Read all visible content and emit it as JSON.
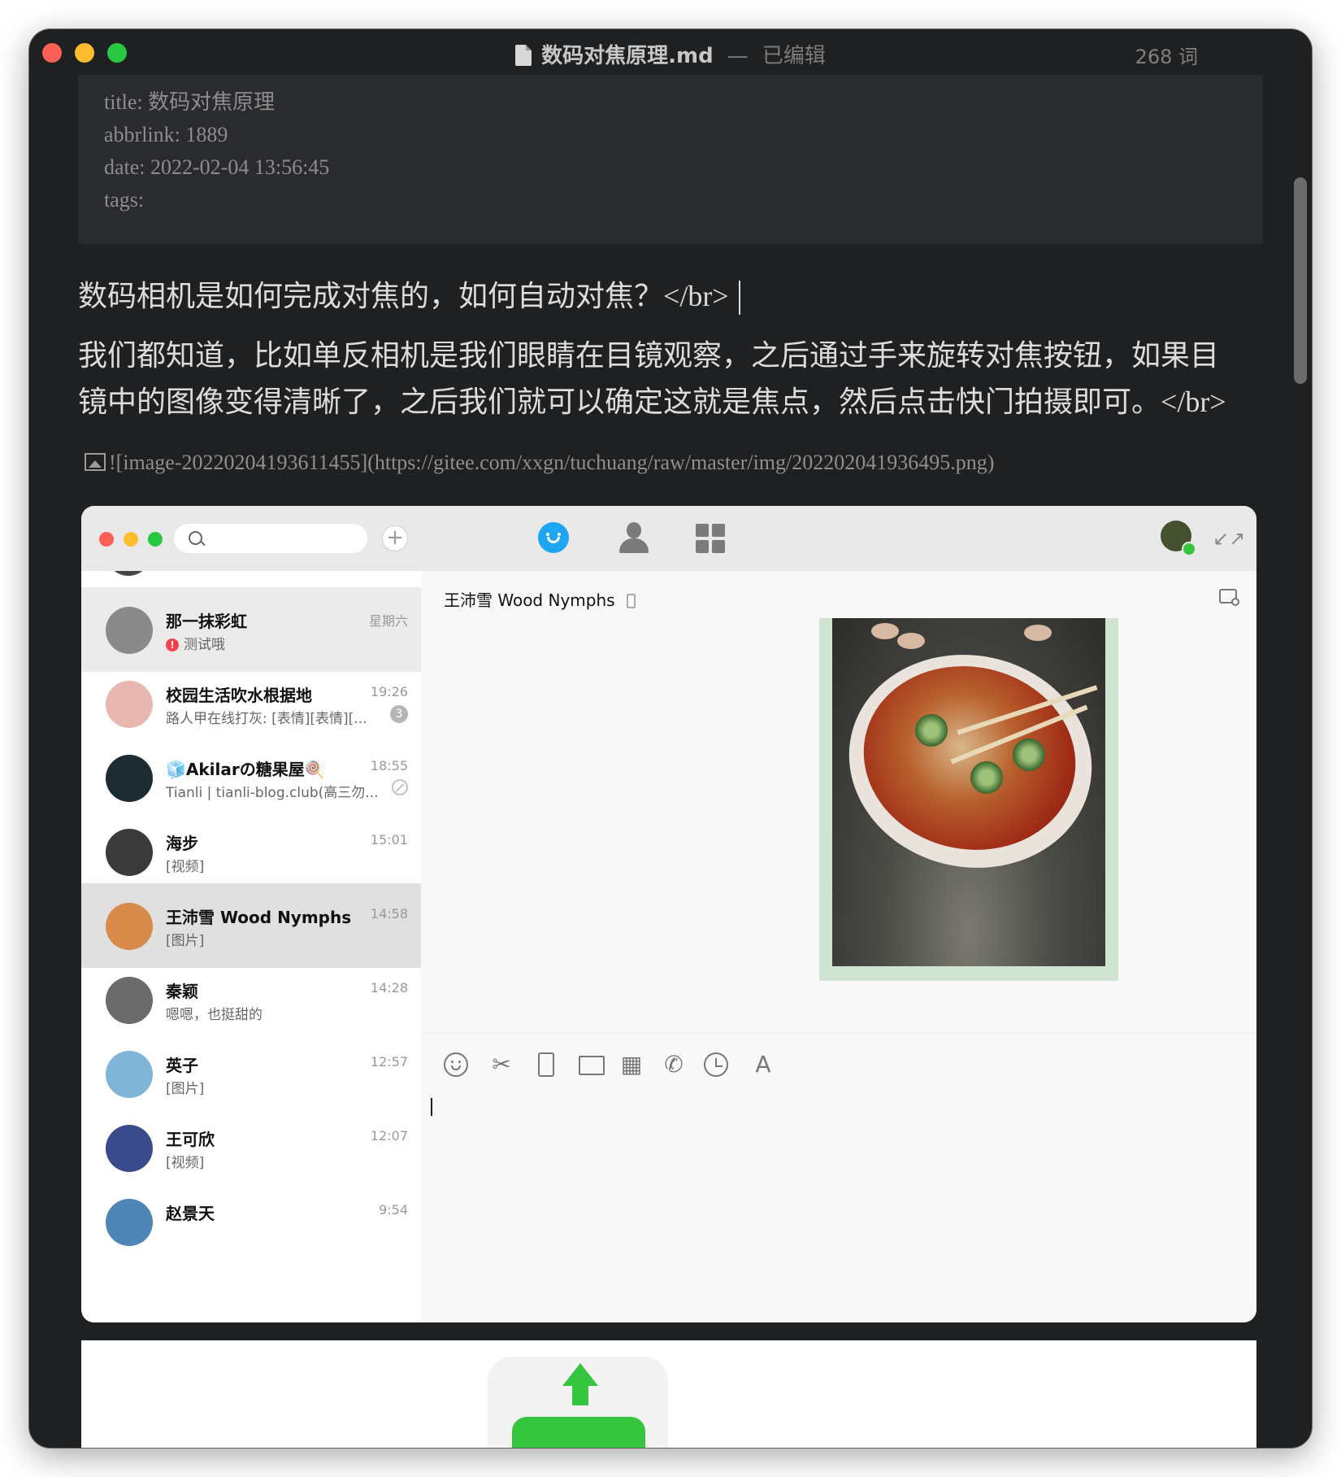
{
  "window": {
    "title": "数码对焦原理.md",
    "separator": "—",
    "edited": "已编辑",
    "word_count": "268 词"
  },
  "frontmatter": {
    "lines": [
      "title: 数码对焦原理",
      "abbrlink: 1889",
      "date: 2022-02-04 13:56:45",
      "tags:"
    ]
  },
  "body": {
    "p1_text": "数码相机是如何完成对焦的，如何自动对焦？",
    "p1_tag": "</br>",
    "p2_line1": "我们都知道，比如单反相机是我们眼睛在目镜观察，之后通过手来旋转对焦按钮，如果目",
    "p2_line2": "镜中的图像变得清晰了，之后我们就可以确定这就是焦点，然后点击快门拍摄即可。",
    "p2_tag": "</br>",
    "image_markdown": "![image-20220204193611455](https://gitee.com/xxgn/tuchuang/raw/master/img/202202041936495.png)"
  },
  "qq": {
    "plus": "+",
    "shrink": "↙↗",
    "chat_title": "王沛雪 Wood Nymphs",
    "conversations": [
      {
        "name": "那一抹彩虹",
        "msg": "测试哦",
        "alert": "!",
        "time": "星期六",
        "avatar_color": "#8a8a8a"
      },
      {
        "name": "校园生活吹水根据地",
        "msg": "路人甲在线打灰: [表情][表情][...",
        "time": "19:26",
        "badge": "3",
        "avatar_color": "#e8b7b0"
      },
      {
        "name": "🧊Akilarの糖果屋🍭",
        "msg": "Tianli | tianli-blog.club(高三勿...",
        "time": "18:55",
        "avatar_color": "#1d2b33"
      },
      {
        "name": "海步",
        "msg": "[视频]",
        "time": "15:01",
        "avatar_color": "#3a3a3a"
      },
      {
        "name": "王沛雪 Wood Nymphs",
        "msg": "[图片]",
        "time": "14:58",
        "avatar_color": "#d68b4b"
      },
      {
        "name": "秦颖",
        "msg": "嗯嗯，也挺甜的",
        "time": "14:28",
        "avatar_color": "#6b6b6b"
      },
      {
        "name": "英子",
        "msg": "[图片]",
        "time": "12:57",
        "avatar_color": "#7fb6d8"
      },
      {
        "name": "王可欣",
        "msg": "[视频]",
        "time": "12:07",
        "avatar_color": "#3b4a8c"
      },
      {
        "name": "赵景天",
        "msg": "",
        "time": "9:54",
        "avatar_color": "#4f86b8"
      }
    ],
    "tools": {
      "scissors": "✂",
      "screenshot": "▦",
      "phone": "✆",
      "font": "A"
    }
  }
}
